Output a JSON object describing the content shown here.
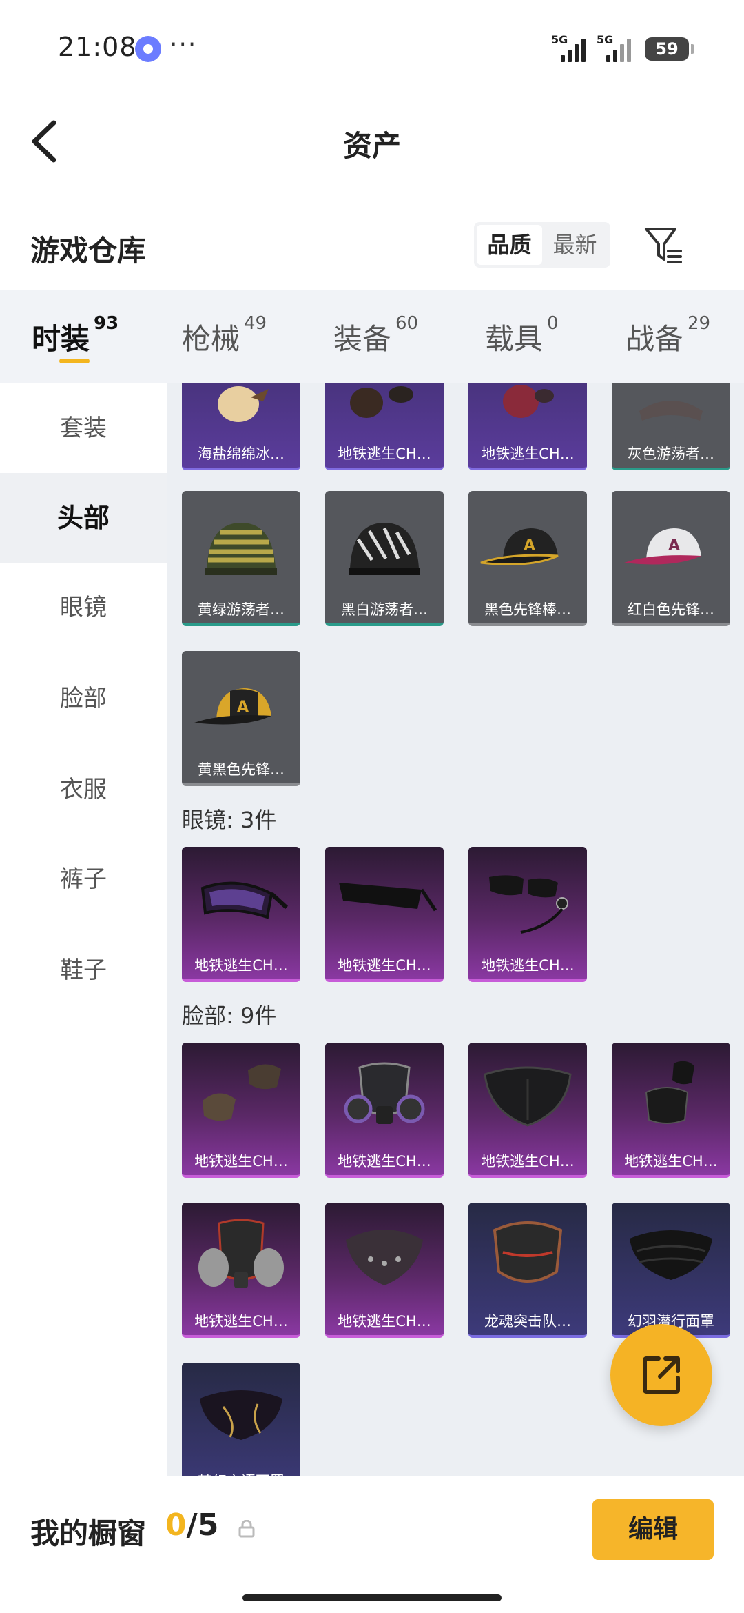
{
  "status": {
    "time": "21:08",
    "more": "···",
    "signal1": "5G",
    "signal2": "5G",
    "battery": "59"
  },
  "header": {
    "title": "资产"
  },
  "warehouse": {
    "title": "游戏仓库",
    "sort_quality": "品质",
    "sort_latest": "最新"
  },
  "tabs": [
    {
      "label": "时装",
      "count": "93"
    },
    {
      "label": "枪械",
      "count": "49"
    },
    {
      "label": "装备",
      "count": "60"
    },
    {
      "label": "载具",
      "count": "0"
    },
    {
      "label": "战备",
      "count": "29"
    }
  ],
  "sidebar": [
    {
      "label": "套装"
    },
    {
      "label": "头部"
    },
    {
      "label": "眼镜"
    },
    {
      "label": "脸部"
    },
    {
      "label": "衣服"
    },
    {
      "label": "裤子"
    },
    {
      "label": "鞋子"
    }
  ],
  "head_items": [
    {
      "name": "海盐绵绵冰…"
    },
    {
      "name": "地铁逃生CH…"
    },
    {
      "name": "地铁逃生CH…"
    },
    {
      "name": "灰色游荡者…"
    },
    {
      "name": "黄绿游荡者…"
    },
    {
      "name": "黑白游荡者…"
    },
    {
      "name": "黑色先锋棒…"
    },
    {
      "name": "红白色先锋…"
    },
    {
      "name": "黄黑色先锋…"
    }
  ],
  "glasses_section": {
    "label": "眼镜: 3件"
  },
  "glasses_items": [
    {
      "name": "地铁逃生CH…"
    },
    {
      "name": "地铁逃生CH…"
    },
    {
      "name": "地铁逃生CH…"
    }
  ],
  "face_section": {
    "label": "脸部: 9件"
  },
  "face_items": [
    {
      "name": "地铁逃生CH…"
    },
    {
      "name": "地铁逃生CH…"
    },
    {
      "name": "地铁逃生CH…"
    },
    {
      "name": "地铁逃生CH…"
    },
    {
      "name": "地铁逃生CH…"
    },
    {
      "name": "地铁逃生CH…"
    },
    {
      "name": "龙魂突击队…"
    },
    {
      "name": "幻羽潜行面罩"
    },
    {
      "name": "梦幻之语面罩"
    }
  ],
  "showcase": {
    "title": "我的橱窗",
    "current": "0",
    "total": "/5",
    "edit_label": "编辑"
  }
}
